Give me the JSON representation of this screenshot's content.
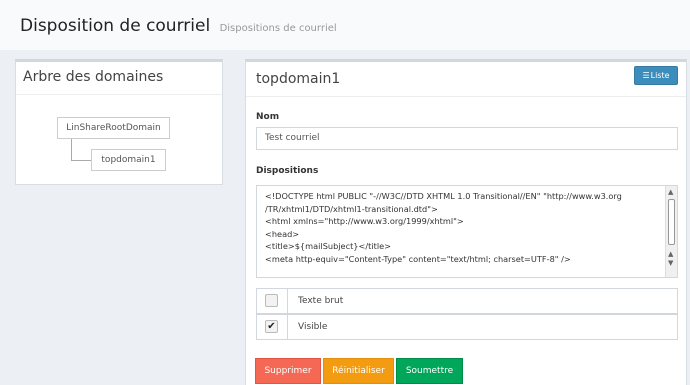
{
  "header": {
    "title": "Disposition de courriel",
    "subtitle": "Dispositions de courriel"
  },
  "tree_panel": {
    "title": "Arbre des domaines",
    "root": "LinShareRootDomain",
    "child": "topdomain1"
  },
  "form_panel": {
    "title": "topdomain1",
    "list_button": "Liste",
    "name_label": "Nom",
    "name_value": "Test courriel",
    "dispositions_label": "Dispositions",
    "dispositions_lines": [
      "<!DOCTYPE html PUBLIC \"-//W3C//DTD XHTML 1.0 Transitional//EN\" \"http://www.w3.org",
      "/TR/xhtml1/DTD/xhtml1-transitional.dtd\">",
      "<html xmlns=\"http://www.w3.org/1999/xhtml\">",
      "<head>",
      "<title>${mailSubject}</title>",
      "<meta http-equiv=\"Content-Type\" content=\"text/html; charset=UTF-8\" />"
    ],
    "options": [
      {
        "label": "Texte brut",
        "checked": false
      },
      {
        "label": "Visible",
        "checked": true
      }
    ],
    "buttons": {
      "delete": "Supprimer",
      "reset": "Réinitialiser",
      "submit": "Soumettre"
    }
  },
  "colors": {
    "primary": "#3c8dbc",
    "danger": "#f56954",
    "warning": "#f39c12",
    "success": "#00a65a"
  },
  "icons": {
    "list": "list-icon",
    "check": "check-icon"
  }
}
